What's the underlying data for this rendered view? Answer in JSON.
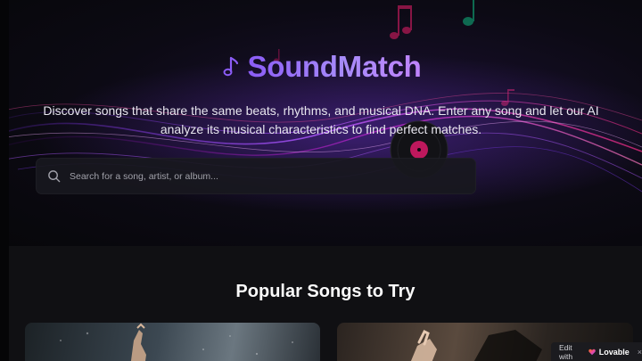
{
  "app": {
    "title": "SoundMatch",
    "tagline": "Discover songs that share the same beats, rhythms, and musical DNA. Enter any song and let our AI analyze its musical characteristics to find perfect matches."
  },
  "search": {
    "placeholder": "Search for a song, artist, or album..."
  },
  "popular": {
    "title": "Popular Songs to Try"
  },
  "badge": {
    "edit_label": "Edit with",
    "brand": "Lovable",
    "close": "×"
  },
  "icons": {
    "brand": "music-note-icon",
    "search": "search-icon",
    "badge": "heart-icon",
    "close": "close-icon"
  },
  "colors": {
    "accent": "#8b5cf6",
    "accent_light": "#c084fc",
    "background": "#0a0a0d",
    "section_bg": "#101013"
  }
}
